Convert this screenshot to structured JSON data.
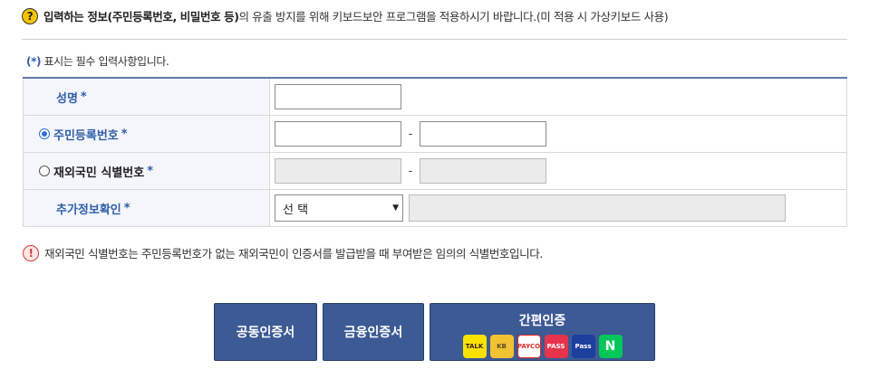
{
  "notice": {
    "prefix_bold": "입력하는 정보(주민등록번호, 비밀번호 등)",
    "rest": "의 유출 방지를 위해 키보드보안 프로그램을 적용하시기 바랍니다.(미 적용 시 가상키보드 사용)"
  },
  "required_note": {
    "star": "(*)",
    "text": " 표시는 필수 입력사항입니다."
  },
  "form": {
    "name_label": "성명",
    "rrn_label": "주민등록번호",
    "foreign_label": "재외국민 식별번호",
    "extra_label": "추가정보확인",
    "required_star": "*",
    "dash": "-",
    "select_value": "선 택"
  },
  "warning": "재외국민 식별번호는 주민등록번호가 없는 재외국민이 인증서를 발급받을 때 부여받은 임의의 식별번호입니다.",
  "buttons": {
    "joint_cert": "공동인증서",
    "financial_cert": "금융인증서",
    "simple_auth": "간편인증",
    "logos": [
      "TALK",
      "KB",
      "PAYCO",
      "PASS",
      "Pass",
      "N"
    ]
  },
  "colors": {
    "accent": "#2f5ea8",
    "button": "#3c5a94",
    "warning": "#d23c3c"
  },
  "icons": {
    "notice": "question-icon",
    "warning": "exclamation-icon",
    "radio_selected": "radio-selected-icon",
    "radio_unselected": "radio-unselected-icon",
    "select_arrow": "triangle-down-icon"
  }
}
